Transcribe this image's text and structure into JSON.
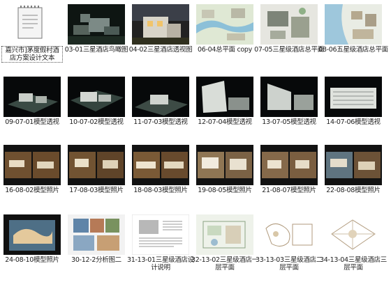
{
  "files": [
    {
      "name": "嘉兴市]茅度假村酒店方案设计文本",
      "kind": "document",
      "selected": true
    },
    {
      "name": "03-01三星酒店鸟瞰图",
      "kind": "night-aerial"
    },
    {
      "name": "04-02三星酒店透视图",
      "kind": "night-facade"
    },
    {
      "name": "06-04总平面 copy",
      "kind": "site-plan-blue"
    },
    {
      "name": "07-05三星级酒店总平面",
      "kind": "site-plan-gray"
    },
    {
      "name": "08-06五星级酒店总平面",
      "kind": "site-plan-water"
    },
    {
      "name": "09-07-01模型透视",
      "kind": "model-dark"
    },
    {
      "name": "10-07-02模型透视",
      "kind": "model-dark"
    },
    {
      "name": "11-07-03模型透视",
      "kind": "model-dark"
    },
    {
      "name": "12-07-04模型透视",
      "kind": "model-tower"
    },
    {
      "name": "13-07-05模型透视",
      "kind": "model-tower"
    },
    {
      "name": "14-07-06模型透视",
      "kind": "model-block"
    },
    {
      "name": "16-08-02模型照片",
      "kind": "photo-pair"
    },
    {
      "name": "17-08-03模型照片",
      "kind": "photo-pair"
    },
    {
      "name": "18-08-03模型照片",
      "kind": "photo-pair"
    },
    {
      "name": "19-08-05模型照片",
      "kind": "photo-pair"
    },
    {
      "name": "21-08-07模型照片",
      "kind": "photo-pair"
    },
    {
      "name": "22-08-08模型照片",
      "kind": "photo-pair"
    },
    {
      "name": "24-08-10模型照片",
      "kind": "photo-model"
    },
    {
      "name": "30-12-2分析图二",
      "kind": "analysis"
    },
    {
      "name": "31-13-01三星级酒店设计说明",
      "kind": "text-page"
    },
    {
      "name": "32-13-02三星级酒店一层平面",
      "kind": "floor-plan"
    },
    {
      "name": "33-13-03三星级酒店二层平面",
      "kind": "floor-plan-light"
    },
    {
      "name": "34-13-04三星级酒店三层平面",
      "kind": "floor-plan-light"
    }
  ]
}
